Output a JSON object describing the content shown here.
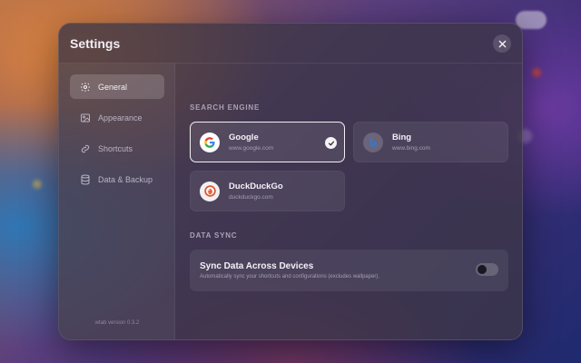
{
  "modal": {
    "title": "Settings",
    "close_icon": "close-icon"
  },
  "sidebar": {
    "items": [
      {
        "id": "general",
        "label": "General",
        "icon": "gear-icon",
        "active": true
      },
      {
        "id": "appearance",
        "label": "Appearance",
        "icon": "image-icon",
        "active": false
      },
      {
        "id": "shortcuts",
        "label": "Shortcuts",
        "icon": "link-icon",
        "active": false
      },
      {
        "id": "data-backup",
        "label": "Data & Backup",
        "icon": "database-icon",
        "active": false
      }
    ],
    "version": "wtab version 0.3.2"
  },
  "search_engine": {
    "title": "SEARCH ENGINE",
    "selected": "google",
    "engines": [
      {
        "id": "google",
        "name": "Google",
        "url": "www.google.com",
        "color": "#4285f4"
      },
      {
        "id": "bing",
        "name": "Bing",
        "url": "www.bing.com",
        "color": "#2b7bd8"
      },
      {
        "id": "duckduckgo",
        "name": "DuckDuckGo",
        "url": "duckduckgo.com",
        "color": "#de5833"
      }
    ]
  },
  "data_sync": {
    "title": "DATA SYNC",
    "label": "Sync Data Across Devices",
    "description": "Automatically sync your shortcuts and configurations (excludes wallpaper).",
    "enabled": false
  }
}
